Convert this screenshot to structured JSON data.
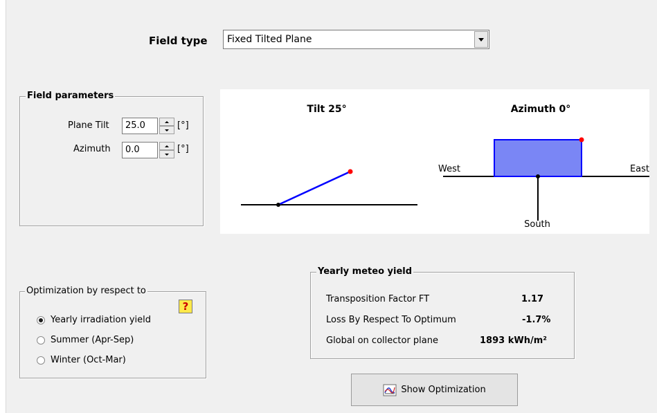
{
  "field_type": {
    "label": "Field type",
    "selected": "Fixed Tilted Plane"
  },
  "field_parameters": {
    "title": "Field parameters",
    "plane_tilt": {
      "label": "Plane Tilt",
      "value": "25.0",
      "unit": "[°]"
    },
    "azimuth": {
      "label": "Azimuth",
      "value": "0.0",
      "unit": "[°]"
    }
  },
  "diagram": {
    "tilt_title": "Tilt 25°",
    "azimuth_title": "Azimuth 0°",
    "west_label": "West",
    "east_label": "East",
    "south_label": "South",
    "plane_fill": "#7a86f5",
    "plane_stroke": "#0000ff",
    "marker_color": "#ff0000"
  },
  "optimization": {
    "title": "Optimization by respect to",
    "options": [
      {
        "label": "Yearly irradiation yield",
        "selected": true
      },
      {
        "label": "Summer (Apr-Sep)",
        "selected": false
      },
      {
        "label": "Winter (Oct-Mar)",
        "selected": false
      }
    ],
    "help_label": "?"
  },
  "meteo_yield": {
    "title": "Yearly meteo yield",
    "rows": [
      {
        "label": "Transposition Factor FT",
        "value": "1.17"
      },
      {
        "label": "Loss By Respect To Optimum",
        "value": "-1.7%"
      },
      {
        "label": "Global on collector plane",
        "value": "1893 kWh/m²"
      }
    ]
  },
  "show_optimization_button": "Show Optimization"
}
